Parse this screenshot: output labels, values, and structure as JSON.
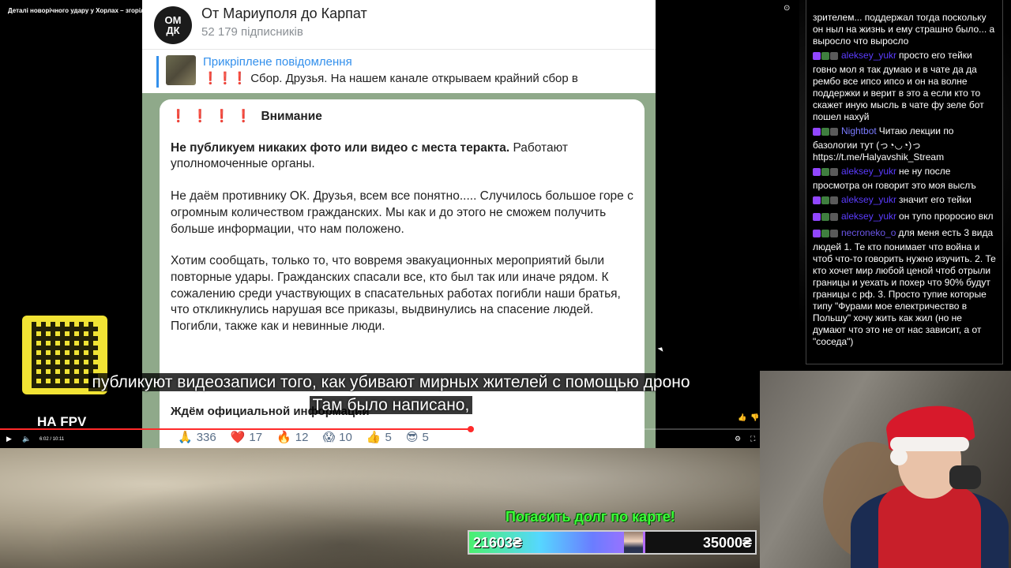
{
  "video": {
    "title": "Деталі новорічного удару у Хорлах – згоріли квартири, Норвежзовані",
    "time": "6:02 / 10:11",
    "progress_fraction": 0.62
  },
  "telegram": {
    "channel_avatar": "ОМ\nДК",
    "channel_title": "От Мариуполя до Карпат",
    "subscribers": "52 179 підписників",
    "pinned_title": "Прикріплене повідомлення",
    "pinned_text": "❗❗❗ Сбор. Друзья.   На нашем канале открываем крайний сбор в",
    "message": {
      "heading_marks": "❗ ❗ ❗ ❗",
      "heading": "Внимание",
      "p1_bold": "Не публикуем никаких фото или видео с места теракта.",
      "p1_rest": " Работают уполномоченные органы.",
      "p2": "Не даём противнику ОК. Друзья, всем все понятно..... Случилось большое горе с огромным количеством гражданских. Мы как и до этого не сможем получить больше информации, что нам положено.",
      "p3": "Хотим сообщать, только то, что вовремя эвакуационных мероприятий были повторные удары. Гражданских спасали все, кто был так или иначе рядом. К сожалению среди участвующих в спасательных работах погибли наши братья, что откликнулись нарушая все приказы, выдвинулись на спасение людей. Погибли, также как и невинные люди.",
      "footer": "Ждём официальной информации"
    },
    "reactions": [
      {
        "emoji": "🙏",
        "count": "336"
      },
      {
        "emoji": "❤️",
        "count": "17"
      },
      {
        "emoji": "🔥",
        "count": "12"
      },
      {
        "emoji": "😱",
        "count": "10"
      },
      {
        "emoji": "👍",
        "count": "5"
      },
      {
        "emoji": "😎",
        "count": "5"
      }
    ]
  },
  "overlay": {
    "fpv_label": "НА FPV",
    "subtitle_line1": "публикуют видеозаписи того, как убивают мирных жителей с помощью дроно",
    "subtitle_line2": "Там было написано,"
  },
  "donation": {
    "title": "Погасить долг по карте!",
    "current": "21603₴",
    "goal": "35000₴",
    "progress_fraction": 0.6172
  },
  "chat": {
    "messages": [
      {
        "user": "",
        "color": "#ffffff",
        "text": "зрителем... поддержал тогда поскольку он ныл на жизнь и ему страшно было... а выросло что выросло"
      },
      {
        "user": "aleksey_yukr",
        "color": "#5b3cff",
        "text": "просто его тейки говно мол я так думаю и в чате да да рембо все ипсо ипсо и он на волне поддержки и верит в это а если кто то скажет иную мысль в чате фу зеле бот пошел нахуй"
      },
      {
        "user": "Nightbot",
        "color": "#7b7bff",
        "text": "Читаю лекции по базологии тут (っ◔◡◔)っ https://t.me/Halyavshik_Stream"
      },
      {
        "user": "aleksey_yukr",
        "color": "#5b3cff",
        "text": "не ну после просмотра он говорит это моя выслъ"
      },
      {
        "user": "aleksey_yukr",
        "color": "#5b3cff",
        "text": "значит его тейки"
      },
      {
        "user": "aleksey_yukr",
        "color": "#5b3cff",
        "text": "он тупо проросио вкл"
      },
      {
        "user": "necroneko_o",
        "color": "#6a55e6",
        "text": "для меня есть 3 вида людей 1. Те кто понимает что война и чтоб что-то говорить нужно изучить. 2. Те кто хочет мир любой ценой чтоб отрыли границы и уехать и похер что 90% будут границы с рф. 3. Просто тупие которые типу \"Фурами мое електричество в Польшу\" хочу жить как жил (но не думают что это не от нас зависит, а от \"соседа\")"
      }
    ]
  }
}
